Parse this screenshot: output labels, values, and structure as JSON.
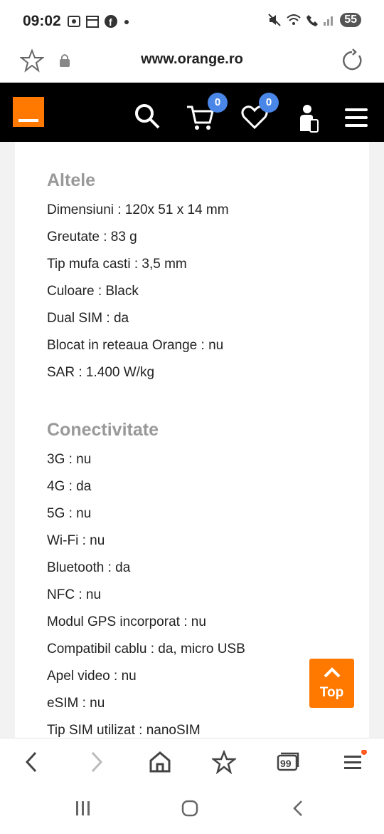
{
  "status": {
    "time": "09:02",
    "battery": "55"
  },
  "browser": {
    "url": "www.orange.ro"
  },
  "header": {
    "cart_count": "0",
    "wishlist_count": "0"
  },
  "sections": [
    {
      "title": "Altele",
      "rows": [
        "Dimensiuni : 120x 51 x 14 mm",
        "Greutate : 83 g",
        "Tip mufa casti : 3,5 mm",
        "Culoare : Black",
        "Dual SIM : da",
        "Blocat in reteaua Orange : nu",
        "SAR : 1.400 W/kg"
      ]
    },
    {
      "title": "Conectivitate",
      "rows": [
        "3G : nu",
        "4G : da",
        "5G : nu",
        "Wi-Fi : nu",
        "Bluetooth : da",
        "NFC : nu",
        "Modul GPS incorporat : nu",
        "Compatibil cablu : da, micro USB",
        "Apel video : nu",
        "eSIM : nu",
        "Tip SIM utilizat : nanoSIM"
      ]
    }
  ],
  "top_button": {
    "label": "Top"
  },
  "tab_count": "99",
  "colors": {
    "brand_orange": "#ff7900",
    "badge_blue": "#4a86e8"
  }
}
